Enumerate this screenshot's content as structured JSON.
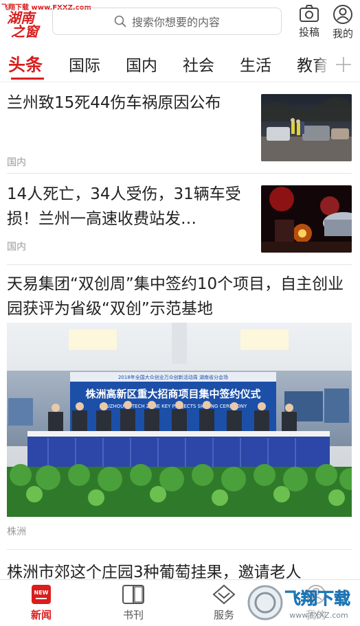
{
  "watermark_top": "飞翔下载 www.FXXZ.com",
  "logo": {
    "line1": "湖南",
    "line2": "之窗"
  },
  "search": {
    "placeholder": "搜索你想要的内容"
  },
  "header_actions": {
    "submit": "投稿",
    "mine": "我的"
  },
  "tabs": [
    {
      "label": "头条",
      "active": true
    },
    {
      "label": "国际"
    },
    {
      "label": "国内"
    },
    {
      "label": "社会"
    },
    {
      "label": "生活"
    },
    {
      "label": "教育"
    }
  ],
  "articles": [
    {
      "title": "兰州致15死44伤车祸原因公布",
      "source": "国内",
      "thumb": "night-accident-scene"
    },
    {
      "title": "14人死亡，34人受伤，31辆车受损！兰州一高速收费站发…",
      "source": "国内",
      "thumb": "night-emergency-lights"
    },
    {
      "title": "天易集团“双创周”集中签约10个项目，自主创业园获评为省级“双创”示范基地",
      "source": "株洲",
      "banner": {
        "top_line": "2018年全国大众创业万众创新活动周  湖南省分会场",
        "main": "株洲高新区重大招商项目集中签约仪式",
        "english": "ZHUZHOU HI-TECH ZONE KEY PROJECTS SIGNING CEREMONY"
      }
    },
    {
      "title": "株洲市郊这个庄园3种葡萄挂果，邀请老人",
      "source": ""
    }
  ],
  "tabbar": [
    {
      "label": "新闻",
      "icon": "news-icon",
      "badge": "NEW",
      "active": true
    },
    {
      "label": "书刊",
      "icon": "book-icon"
    },
    {
      "label": "服务",
      "icon": "service-icon"
    },
    {
      "label": "我的",
      "icon": "user-icon"
    }
  ],
  "watermark_bottom": {
    "main": "飞翔下载",
    "url": "www.FXXZ.com"
  },
  "colors": {
    "accent": "#d81e1e",
    "text": "#222222",
    "muted": "#999999"
  }
}
